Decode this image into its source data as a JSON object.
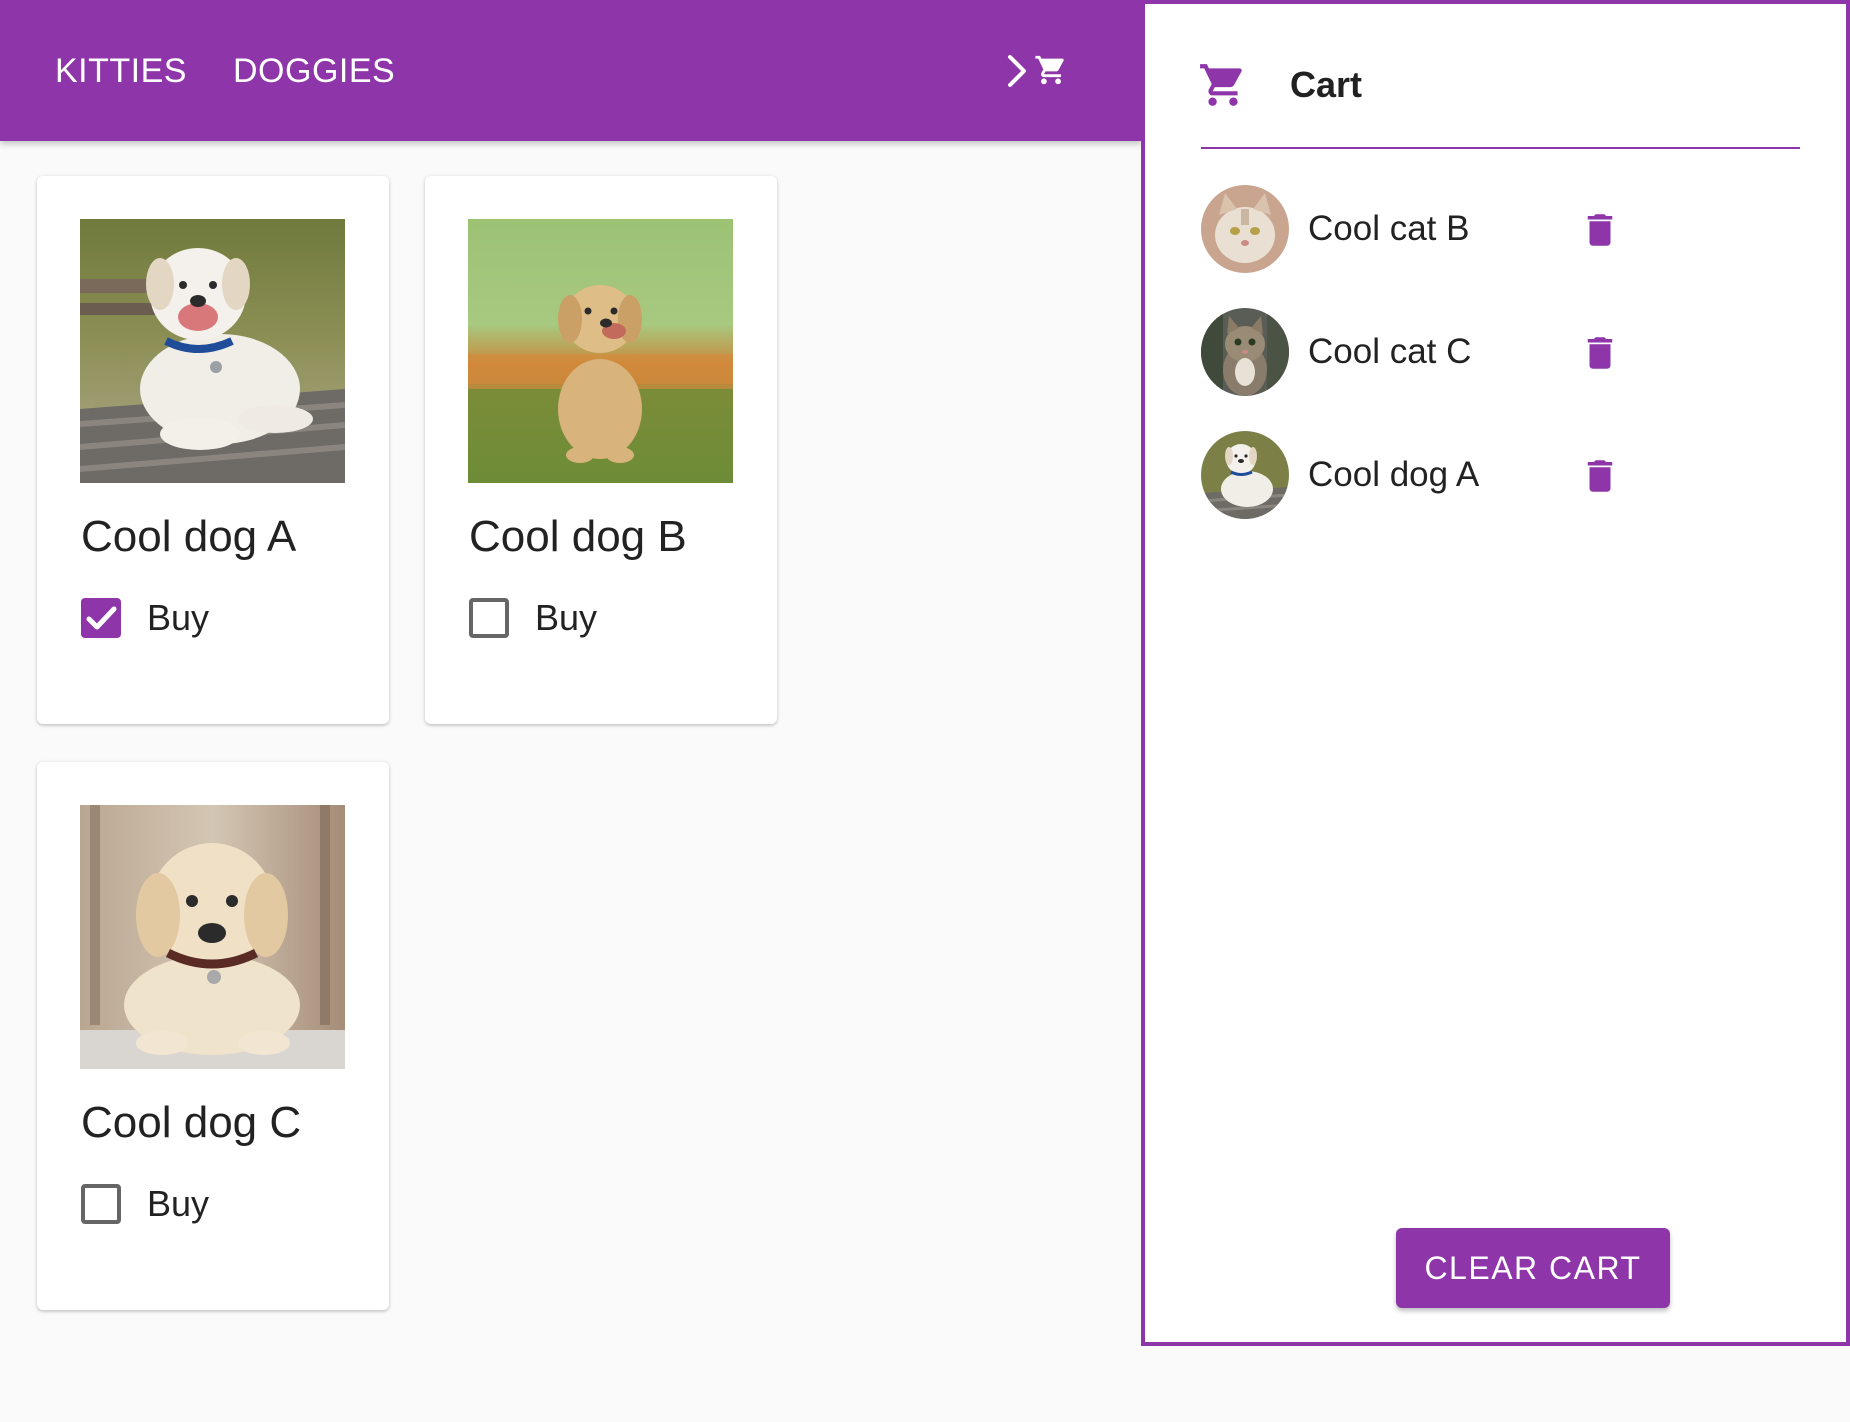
{
  "nav": {
    "tabs": [
      {
        "label": "KITTIES"
      },
      {
        "label": "DOGGIES"
      }
    ],
    "chevron_icon": "chevron-right-icon",
    "cart_icon": "shopping-cart-icon"
  },
  "products": [
    {
      "title": "Cool dog A",
      "buy_label": "Buy",
      "checked": true
    },
    {
      "title": "Cool dog B",
      "buy_label": "Buy",
      "checked": false
    },
    {
      "title": "Cool dog C",
      "buy_label": "Buy",
      "checked": false
    }
  ],
  "cart": {
    "title": "Cart",
    "icon": "shopping-cart-icon",
    "items": [
      {
        "name": "Cool cat B",
        "delete_icon": "trash-icon"
      },
      {
        "name": "Cool cat C",
        "delete_icon": "trash-icon"
      },
      {
        "name": "Cool dog A",
        "delete_icon": "trash-icon"
      }
    ],
    "clear_label": "CLEAR CART"
  },
  "colors": {
    "accent": "#8e35a9",
    "background": "#fafafa",
    "surface": "#ffffff"
  }
}
